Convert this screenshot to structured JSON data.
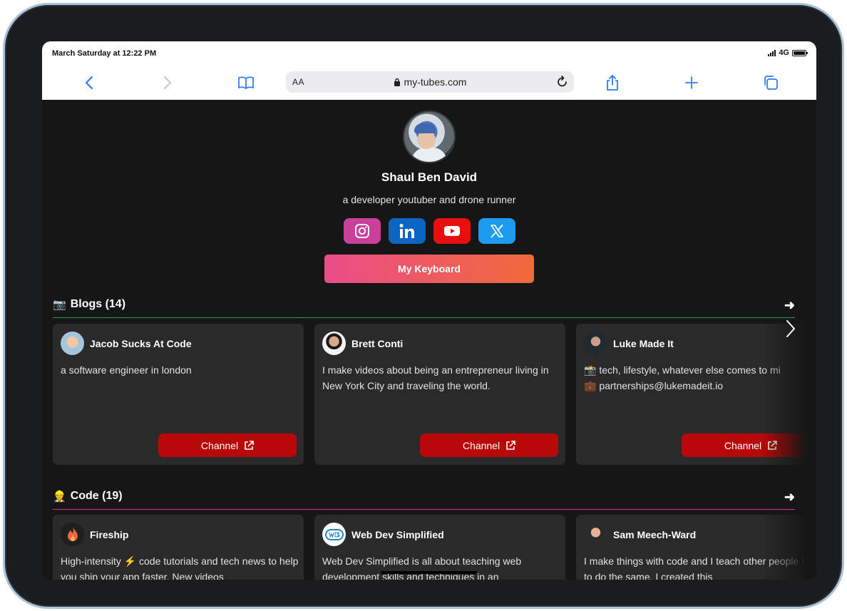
{
  "status_bar": {
    "time": "March Saturday at 12:22 PM",
    "network": "4G"
  },
  "browser": {
    "text_size_label": "AA",
    "url": "my-tubes.com"
  },
  "profile": {
    "name": "Shaul Ben David",
    "bio": "a developer youtuber and drone runner",
    "socials": [
      {
        "name": "instagram",
        "color": "#c8409a"
      },
      {
        "name": "linkedin",
        "color": "#0a66c2"
      },
      {
        "name": "youtube",
        "color": "#ea0f0f"
      },
      {
        "name": "x",
        "color": "#1d9bf0"
      }
    ],
    "cta_label": "My Keyboard"
  },
  "sections": [
    {
      "emoji": "📷",
      "title": "Blogs (14)",
      "rule_color": "#1f9d4c",
      "cards": [
        {
          "name": "Jacob Sucks At Code",
          "description": "a software engineer in london",
          "button": "Channel"
        },
        {
          "name": "Brett Conti",
          "description": "I make videos about being an entrepreneur living in New York City and traveling the world.",
          "button": "Channel"
        },
        {
          "name": "Luke Made It",
          "description": "📸 tech, lifestyle, whatever else comes to mi\n💼 partnerships@lukemadeit.io",
          "button": "Channel"
        }
      ]
    },
    {
      "emoji": "👷",
      "title": "Code (19)",
      "rule_color": "#d1367e",
      "cards": [
        {
          "name": "Fireship",
          "description": "High-intensity ⚡ code tutorials and tech news to help you ship your app faster. New videos"
        },
        {
          "name": "Web Dev Simplified",
          "description": "Web Dev Simplified is all about teaching web development skills and techniques in an"
        },
        {
          "name": "Sam Meech-Ward",
          "description": "I make things with code and I teach other people how to do the same. I created this"
        }
      ]
    }
  ]
}
